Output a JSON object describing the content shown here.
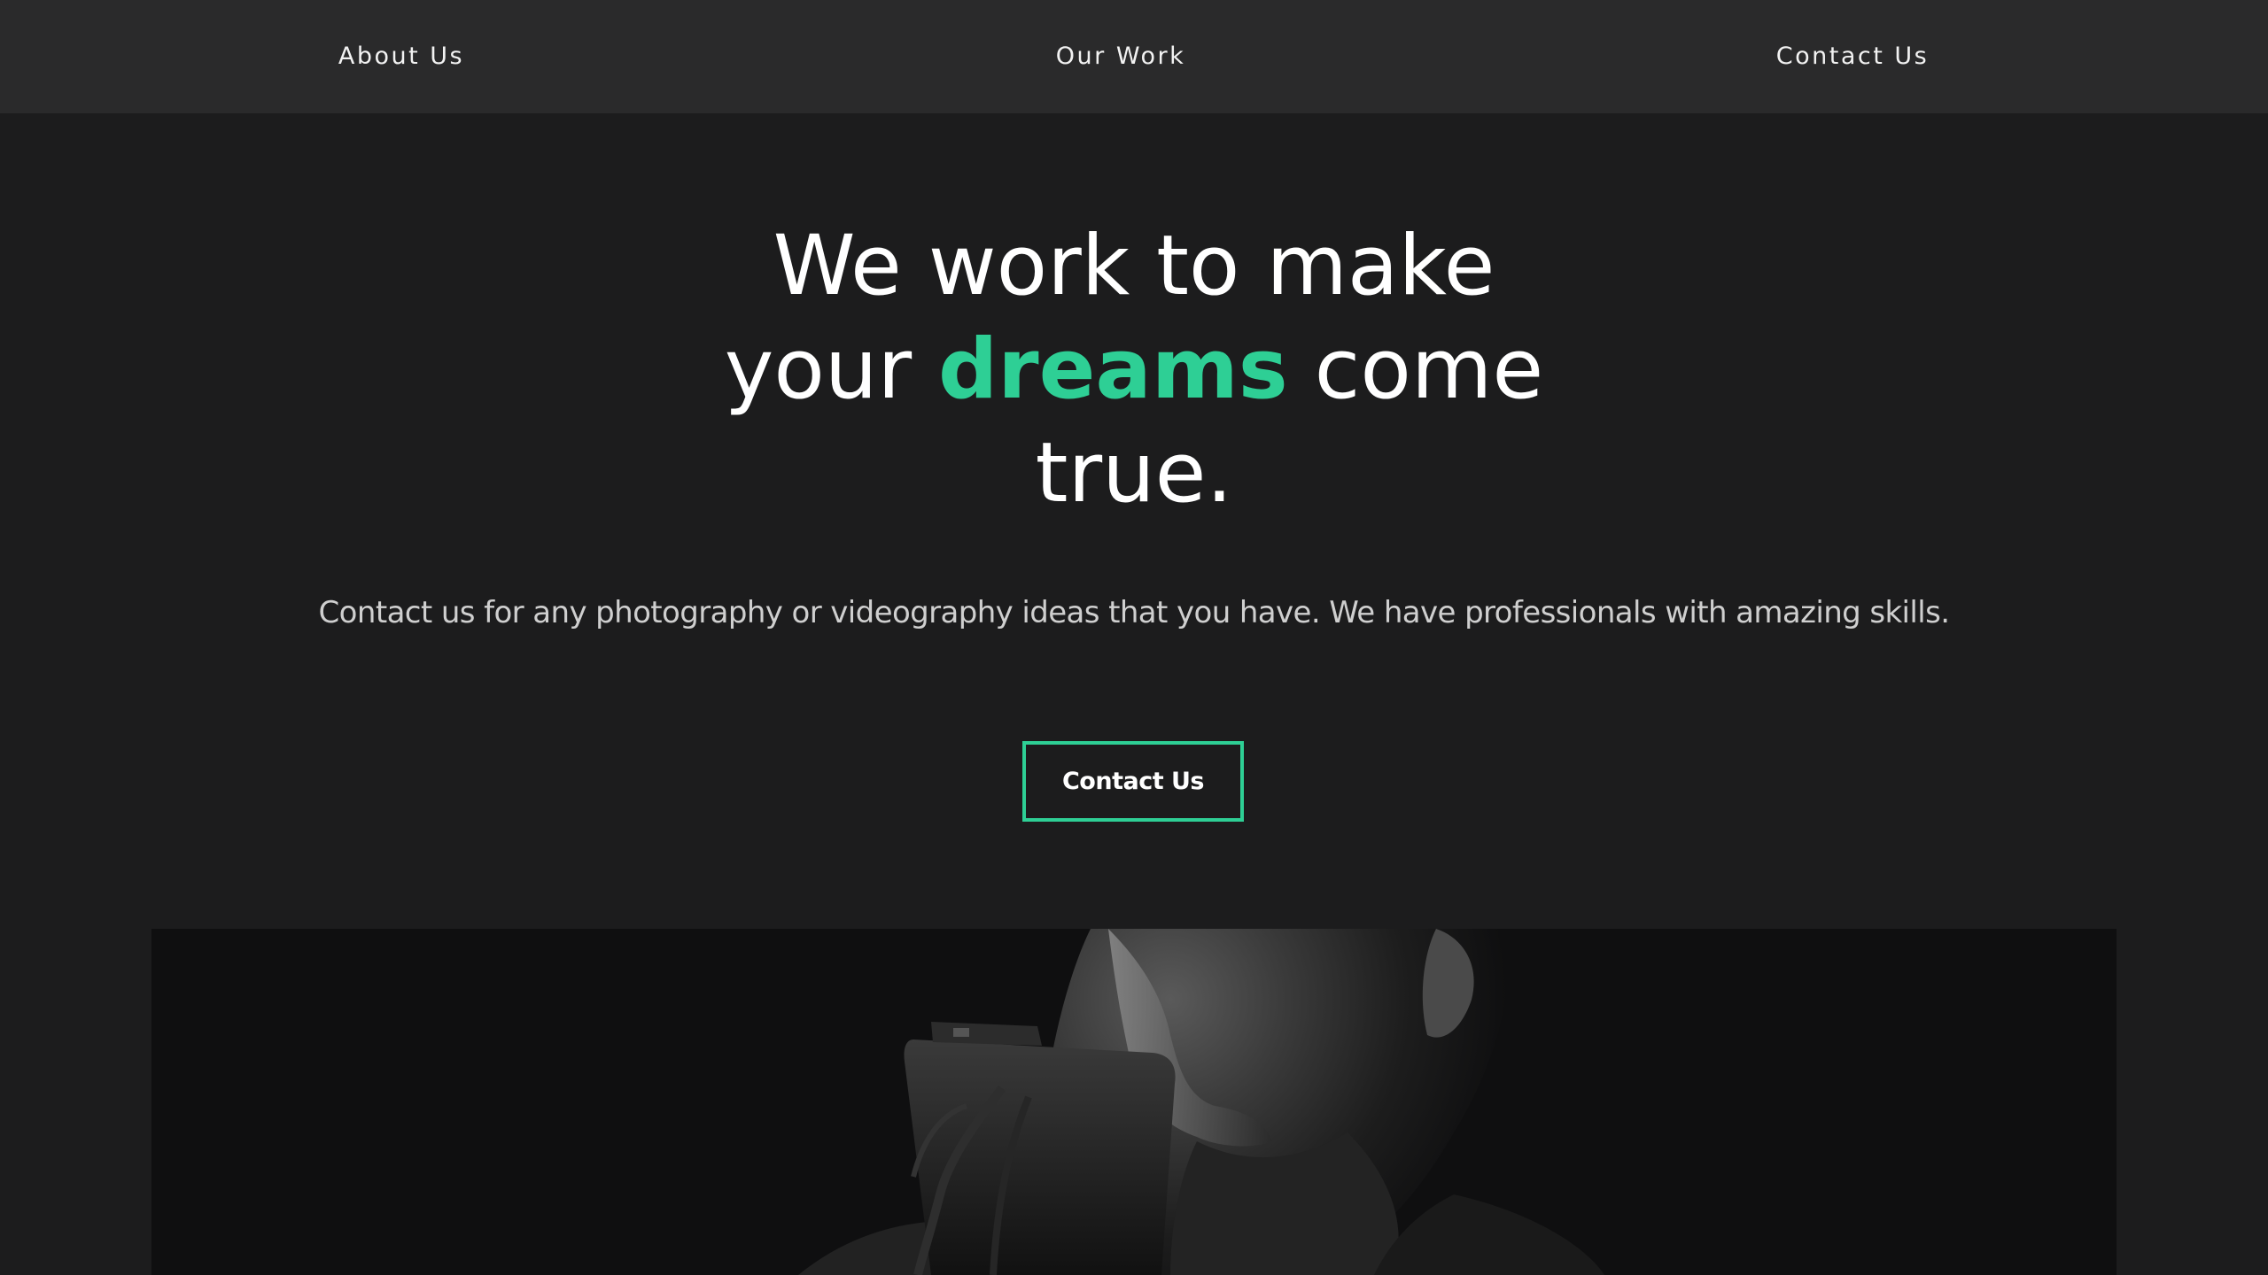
{
  "nav": {
    "items": [
      {
        "label": "About Us"
      },
      {
        "label": "Our Work"
      },
      {
        "label": "Contact Us"
      }
    ]
  },
  "hero": {
    "title_part1": "We work to make your",
    "title_accent": "dreams",
    "title_part2": "come true.",
    "subtitle": "Contact us for any photography or videography ideas that you have. We have professionals with amazing skills.",
    "cta_label": "Contact Us"
  },
  "colors": {
    "background": "#1c1c1d",
    "navbar": "#2a2a2b",
    "accent": "#2ecf95",
    "text": "#ffffff"
  }
}
